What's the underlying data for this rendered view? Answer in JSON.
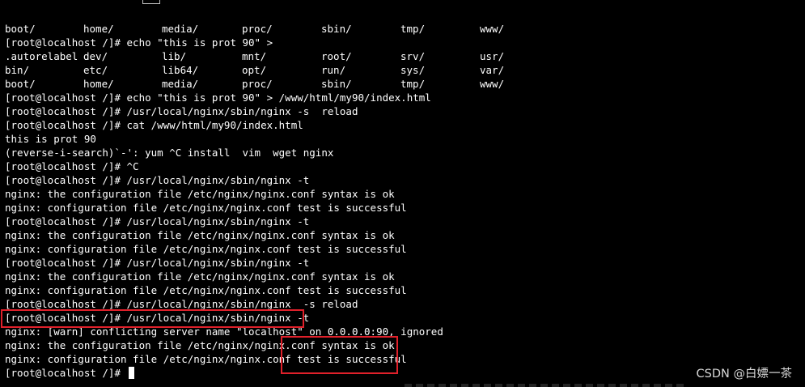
{
  "terminal": {
    "listing_rows": [
      [
        "boot/",
        "home/",
        "media/",
        "proc/",
        "sbin/",
        "tmp/",
        "www/"
      ],
      [
        ".autorelabel",
        "dev/",
        "lib/",
        "mnt/",
        "root/",
        "srv/",
        "usr/"
      ],
      [
        "bin/",
        "etc/",
        "lib64/",
        "opt/",
        "run/",
        "sys/",
        "var/"
      ],
      [
        "boot/",
        "home/",
        "media/",
        "proc/",
        "sbin/",
        "tmp/",
        "www/"
      ]
    ],
    "lines": [
      "[root@localhost /]# echo \"this is prot 90\" >",
      "[root@localhost /]# echo \"this is prot 90\" > /www/html/my90/index.html",
      "[root@localhost /]# /usr/local/nginx/sbin/nginx -s  reload",
      "[root@localhost /]# cat /www/html/my90/index.html",
      "this is prot 90",
      "(reverse-i-search)`-': yum ^C install  vim  wget nginx",
      "[root@localhost /]# ^C",
      "[root@localhost /]# /usr/local/nginx/sbin/nginx -t",
      "nginx: the configuration file /etc/nginx/nginx.conf syntax is ok",
      "nginx: configuration file /etc/nginx/nginx.conf test is successful",
      "[root@localhost /]# /usr/local/nginx/sbin/nginx -t",
      "nginx: the configuration file /etc/nginx/nginx.conf syntax is ok",
      "nginx: configuration file /etc/nginx/nginx.conf test is successful",
      "[root@localhost /]# /usr/local/nginx/sbin/nginx -t",
      "nginx: the configuration file /etc/nginx/nginx.conf syntax is ok",
      "nginx: configuration file /etc/nginx/nginx.conf test is successful",
      "[root@localhost /]# /usr/local/nginx/sbin/nginx  -s reload",
      "[root@localhost /]# /usr/local/nginx/sbin/nginx -t",
      "nginx: [warn] conflicting server name \"localhost\" on 0.0.0.0:90, ignored",
      "nginx: the configuration file /etc/nginx/nginx.conf syntax is ok",
      "nginx: configuration file /etc/nginx/nginx.conf test is successful",
      "[root@localhost /]# "
    ]
  },
  "watermark": "CSDN @白嫖一茶",
  "colors": {
    "background": "#000000",
    "text": "#ffffff",
    "highlight": "#e0202a"
  }
}
